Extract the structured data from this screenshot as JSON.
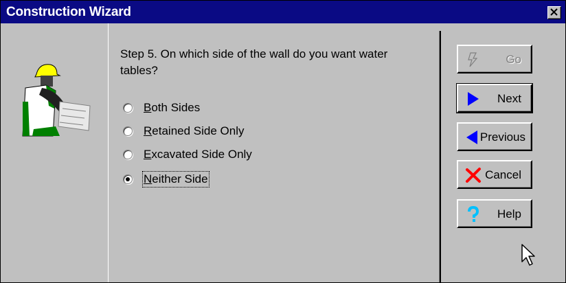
{
  "window": {
    "title": "Construction Wizard"
  },
  "wizard": {
    "question": "Step 5. On which side of the wall do you want water tables?",
    "options": [
      {
        "label_access": "B",
        "label_rest": "oth Sides",
        "selected": false
      },
      {
        "label_access": "R",
        "label_rest": "etained Side Only",
        "selected": false
      },
      {
        "label_access": "E",
        "label_rest": "xcavated Side Only",
        "selected": false
      },
      {
        "label_access": "N",
        "label_rest": "either Side",
        "selected": true
      }
    ]
  },
  "buttons": {
    "go": "Go",
    "next": "Next",
    "previous": "Previous",
    "cancel": "Cancel",
    "help": "Help"
  },
  "icons": {
    "go": "lightning-icon",
    "next": "arrow-right-icon",
    "previous": "arrow-left-icon",
    "cancel": "red-x-icon",
    "help": "question-mark-icon",
    "close": "close-icon"
  },
  "colors": {
    "titlebar": "#0a0a84",
    "arrow": "#0000ff",
    "cancel": "#ff0000",
    "help": "#00c0ff"
  }
}
